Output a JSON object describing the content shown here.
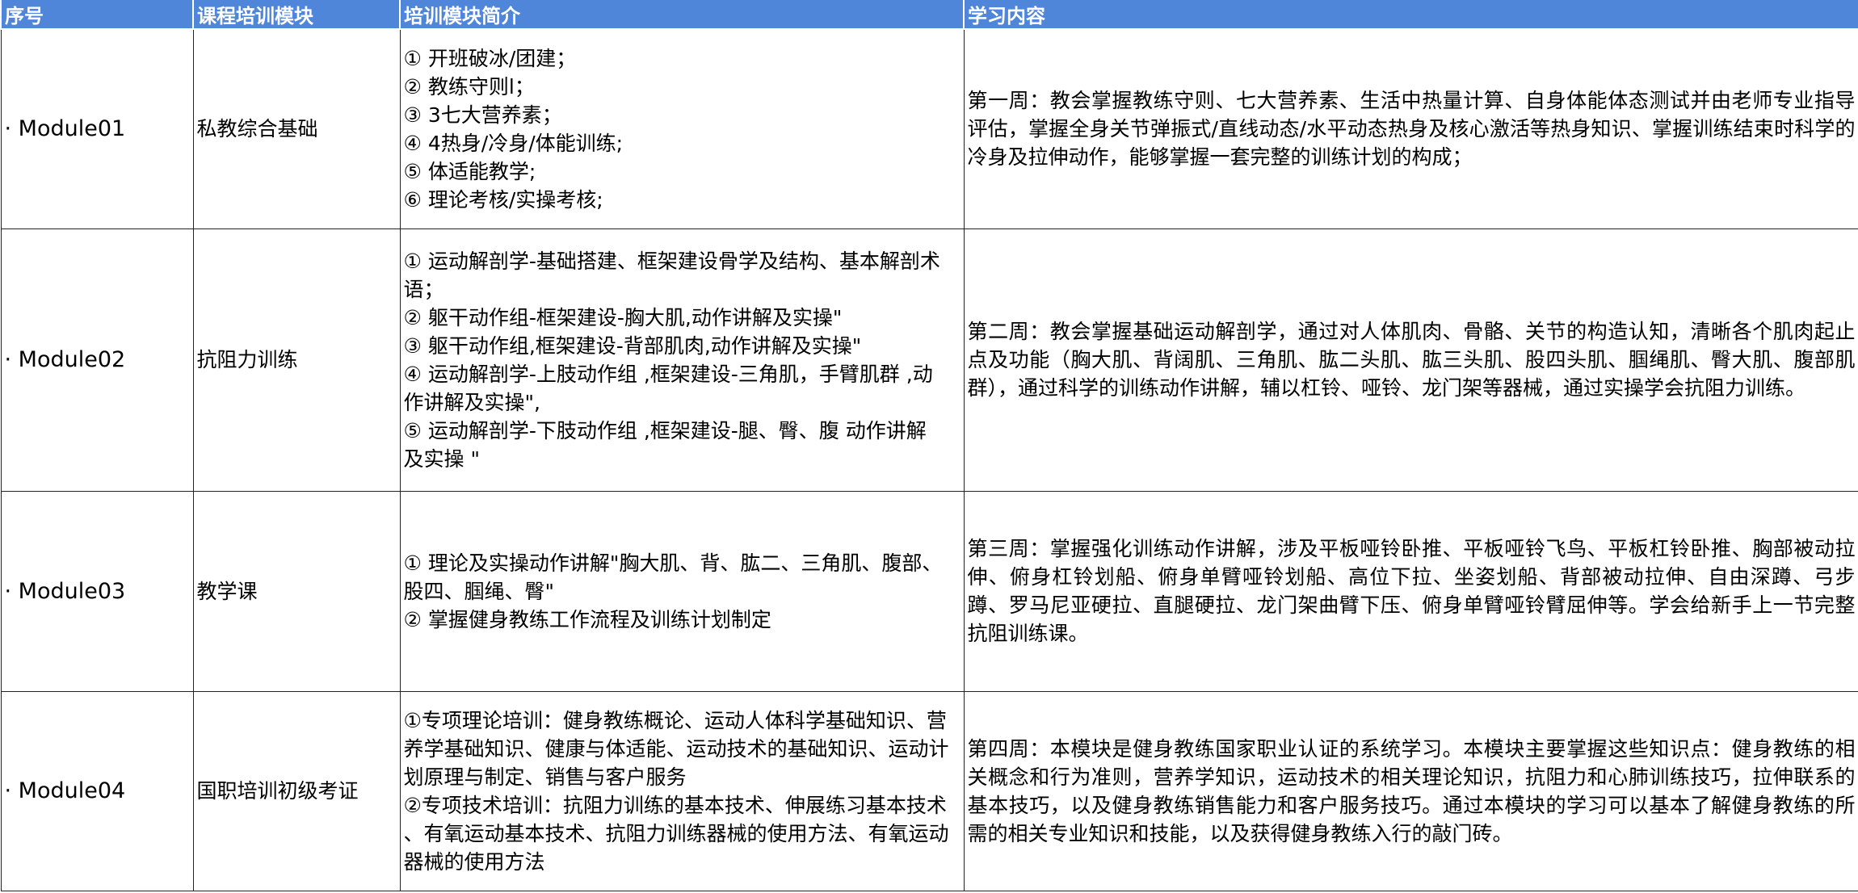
{
  "header": {
    "col_no": "序号",
    "col_module": "课程培训模块",
    "col_brief": "培训模块简介",
    "col_content": "学习内容"
  },
  "rows": [
    {
      "no": "· Module01",
      "module": "私教综合基础",
      "brief": [
        "① 开班破冰/团建；",
        "② 教练守则l；",
        "③ 3七大营养素；",
        "④ 4热身/冷身/体能训练;",
        "⑤ 体适能教学;",
        "⑥ 理论考核/实操考核;"
      ],
      "content": "第一周：教会掌握教练守则、七大营养素、生活中热量计算、自身体能体态测试并由老师专业指导评估，掌握全身关节弹振式/直线动态/水平动态热身及核心激活等热身知识、掌握训练结束时科学的冷身及拉伸动作，能够掌握一套完整的训练计划的构成；"
    },
    {
      "no": "· Module02",
      "module": "抗阻力训练",
      "brief": [
        "① 运动解剖学-基础搭建、框架建设骨学及结构、基本解剖术",
        "语；",
        "② 躯干动作组-框架建设-胸大肌,动作讲解及实操\"",
        "③ 躯干动作组,框架建设-背部肌肉,动作讲解及实操\"",
        "④ 运动解剖学-上肢动作组 ,框架建设-三角肌，手臂肌群 ,动",
        "作讲解及实操\",",
        "⑤ 运动解剖学-下肢动作组 ,框架建设-腿、臀、腹  动作讲解",
        "及实操 \""
      ],
      "content": "第二周：教会掌握基础运动解剖学，通过对人体肌肉、骨骼、关节的构造认知，清晰各个肌肉起止点及功能（胸大肌、背阔肌、三角肌、肱二头肌、肱三头肌、股四头肌、腘绳肌、臀大肌、腹部肌群），通过科学的训练动作讲解，辅以杠铃、哑铃、龙门架等器械，通过实操学会抗阻力训练。"
    },
    {
      "no": "· Module03",
      "module": "教学课",
      "brief": [
        "① 理论及实操动作讲解\"胸大肌、背、肱二、三角肌、腹部、",
        "股四、腘绳、臀\"",
        "② 掌握健身教练工作流程及训练计划制定"
      ],
      "content": "第三周：掌握强化训练动作讲解，涉及平板哑铃卧推、平板哑铃飞鸟、平板杠铃卧推、胸部被动拉伸、俯身杠铃划船、俯身单臂哑铃划船、高位下拉、坐姿划船、背部被动拉伸、自由深蹲、弓步蹲、罗马尼亚硬拉、直腿硬拉、龙门架曲臂下压、俯身单臂哑铃臂屈伸等。学会给新手上一节完整抗阻训练课。"
    },
    {
      "no": "· Module04",
      "module": "国职培训初级考证",
      "brief": [
        "①专项理论培训：健身教练概论、运动人体科学基础知识、营",
        "养学基础知识、健康与体适能、运动技术的基础知识、运动计",
        "划原理与制定、销售与客户服务",
        "②专项技术培训：抗阻力训练的基本技术、伸展练习基本技术",
        "、有氧运动基本技术、抗阻力训练器械的使用方法、有氧运动",
        "器械的使用方法"
      ],
      "content": "第四周：本模块是健身教练国家职业认证的系统学习。本模块主要掌握这些知识点：健身教练的相关概念和行为准则，营养学知识，运动技术的相关理论知识，抗阻力和心肺训练技巧，拉伸联系的基本技巧，以及健身教练销售能力和客户服务技巧。通过本模块的学习可以基本了解健身教练的所需的相关专业知识和技能，以及获得健身教练入行的敲门砖。"
    }
  ]
}
